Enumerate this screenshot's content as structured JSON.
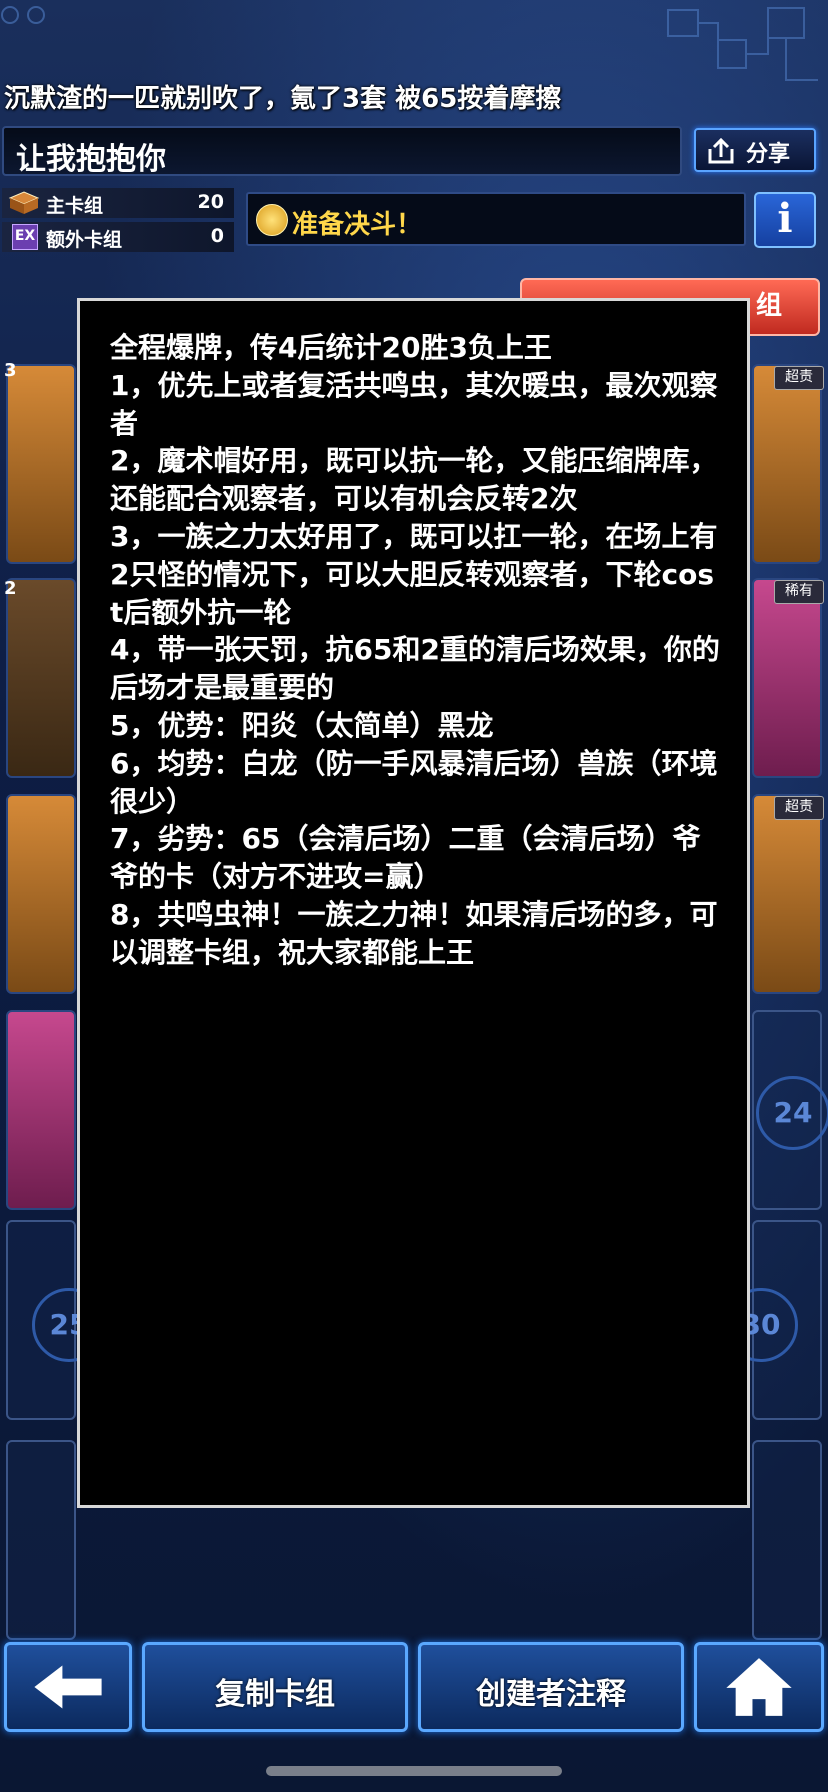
{
  "header": {
    "subtitle": "沉默渣的一匹就别吹了，氪了3套 被65按着摩擦",
    "deck_title": "让我抱抱你",
    "share_label": "分享"
  },
  "deck_counts": {
    "main_label": "主卡组",
    "main_count": "20",
    "extra_badge": "EX",
    "extra_label": "额外卡组",
    "extra_count": "0"
  },
  "duel": {
    "ready_label": "准备决斗！",
    "info_label": "i"
  },
  "sort_button": {
    "label": "组"
  },
  "card_grid": {
    "stars": [
      "3",
      "2"
    ],
    "rarities": [
      "超责",
      "稀有",
      "超责"
    ],
    "attributes": [
      "炎",
      "暗"
    ],
    "slot_numbers": [
      "24",
      "25",
      "30"
    ]
  },
  "creator_note": {
    "lines": [
      "全程爆牌，传4后统计20胜3负上王",
      "1，优先上或者复活共鸣虫，其次暖虫，最次观察者",
      "2，魔术帽好用，既可以抗一轮，又能压缩牌库，还能配合观察者，可以有机会反转2次",
      "3，一族之力太好用了，既可以扛一轮，在场上有2只怪的情况下，可以大胆反转观察者，下轮cost后额外抗一轮",
      "4，带一张天罚，抗65和2重的清后场效果，你的后场才是最重要的",
      "5，优势：阳炎（太简单）黑龙",
      "6，均势：白龙（防一手风暴清后场）兽族（环境很少）",
      "7，劣势：65（会清后场）二重（会清后场）爷爷的卡（对方不进攻=赢）",
      "8，共鸣虫神！一族之力神！如果清后场的多，可以调整卡组，祝大家都能上王"
    ]
  },
  "bottom_bar": {
    "copy_label": "复制卡组",
    "notes_label": "创建者注释"
  },
  "colors": {
    "accent_blue": "#5aa8ff",
    "gold": "#ffd74a",
    "dialog_bg": "#000000",
    "dialog_border": "#d8d8d8"
  }
}
